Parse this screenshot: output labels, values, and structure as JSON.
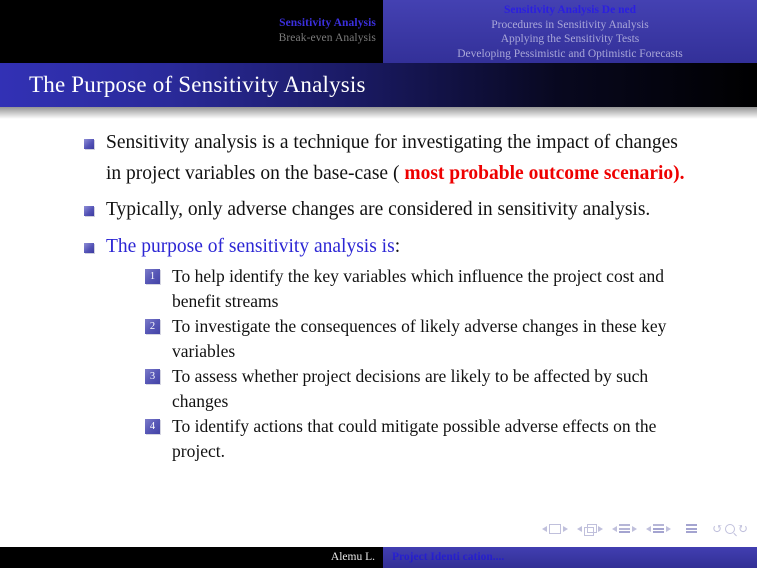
{
  "navigation": {
    "sections": [
      {
        "label": "Sensitivity Analysis",
        "active": true
      },
      {
        "label": "Break-even Analysis",
        "active": false
      }
    ],
    "subsections": [
      {
        "label": "Sensitivity Analysis De ned",
        "active": true
      },
      {
        "label": "Procedures in Sensitivity Analysis",
        "active": false
      },
      {
        "label": "Applying the Sensitivity Tests",
        "active": false
      },
      {
        "label": "Developing Pessimistic and Optimistic Forecasts",
        "active": false
      }
    ]
  },
  "title": "The Purpose of Sensitivity Analysis",
  "content": {
    "bullets": [
      {
        "plain_prefix": "Sensitivity analysis is a technique for investigating the impact of changes in project variables on the base-case (",
        "emphasis": "most probable outcome scenario).",
        "emphasis_color": "#ee0000"
      },
      {
        "plain_prefix": "Typically, only adverse changes are considered in sensitivity analysis.",
        "emphasis": "",
        "emphasis_color": ""
      },
      {
        "plain_prefix": "",
        "emphasis": "The purpose of sensitivity analysis is",
        "emphasis_color": "#2c26d4",
        "suffix": ":"
      }
    ],
    "enumerated": [
      {
        "number": "1",
        "text": "To help identify the key variables which influence the project cost and benefit streams"
      },
      {
        "number": "2",
        "text": "To investigate the consequences of likely adverse changes in these key variables"
      },
      {
        "number": "3",
        "text": "To assess whether project decisions are likely to be affected by such changes"
      },
      {
        "number": "4",
        "text": "To identify actions that could mitigate possible adverse effects on the project."
      }
    ]
  },
  "nav_symbols": {
    "slide": "slide-navigation",
    "frame": "frame-navigation",
    "subsection": "subsection-navigation",
    "section": "section-navigation",
    "document": "document-navigation",
    "back": "↺",
    "forward": "↻"
  },
  "footer": {
    "author": "Alemu L.",
    "document_title": "Project Identi cation...."
  },
  "colors": {
    "accent_blue": "#3a37ae",
    "title_blue": "#3231b5",
    "bullet": "#5554b7",
    "emphasis_red": "#ee0000",
    "link_blue": "#2c26d4"
  }
}
